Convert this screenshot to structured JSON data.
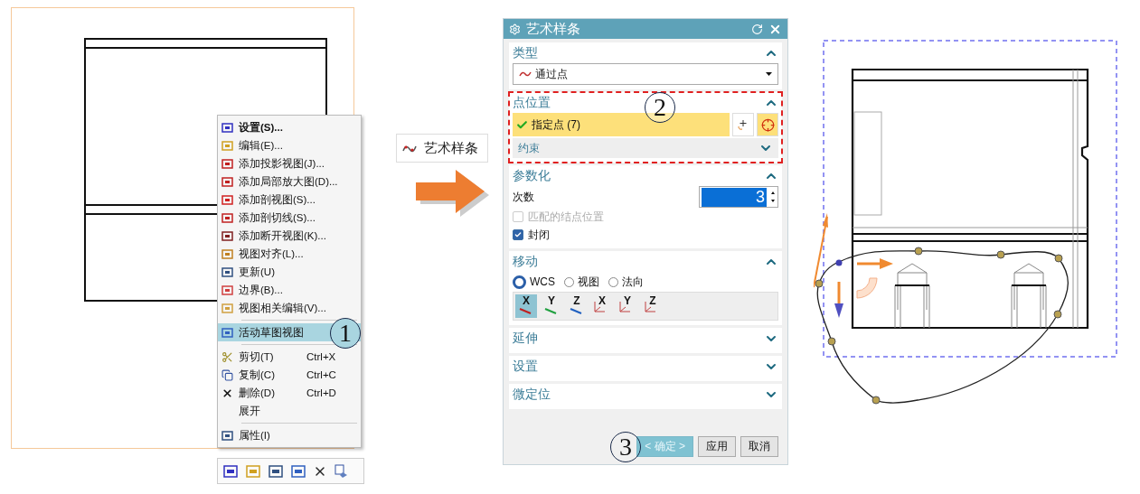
{
  "context_menu": {
    "callout": "1",
    "items": [
      {
        "kind": "item",
        "label": "设置(S)...",
        "bold": true,
        "selected": false
      },
      {
        "kind": "item",
        "label": "编辑(E)...",
        "bold": false,
        "selected": false
      },
      {
        "kind": "item",
        "label": "添加投影视图(J)...",
        "bold": false,
        "selected": false
      },
      {
        "kind": "item",
        "label": "添加局部放大图(D)...",
        "bold": false,
        "selected": false
      },
      {
        "kind": "item",
        "label": "添加剖视图(S)...",
        "bold": false,
        "selected": false
      },
      {
        "kind": "item",
        "label": "添加剖切线(S)...",
        "bold": false,
        "selected": false
      },
      {
        "kind": "item",
        "label": "添加断开视图(K)...",
        "bold": false,
        "selected": false
      },
      {
        "kind": "item",
        "label": "视图对齐(L)...",
        "bold": false,
        "selected": false
      },
      {
        "kind": "item",
        "label": "更新(U)",
        "bold": false,
        "selected": false
      },
      {
        "kind": "item",
        "label": "边界(B)...",
        "bold": false,
        "selected": false
      },
      {
        "kind": "item",
        "label": "视图相关编辑(V)...",
        "bold": false,
        "selected": false
      },
      {
        "kind": "separator"
      },
      {
        "kind": "item",
        "label": "活动草图视图",
        "bold": false,
        "selected": true
      },
      {
        "kind": "separator"
      },
      {
        "kind": "item",
        "label": "剪切(T)",
        "shortcut": "Ctrl+X",
        "bold": false,
        "selected": false
      },
      {
        "kind": "item",
        "label": "复制(C)",
        "shortcut": "Ctrl+C",
        "bold": false,
        "selected": false
      },
      {
        "kind": "item",
        "label": "删除(D)",
        "shortcut": "Ctrl+D",
        "bold": false,
        "selected": false
      },
      {
        "kind": "item",
        "label": "展开",
        "bold": false,
        "selected": false
      },
      {
        "kind": "separator"
      },
      {
        "kind": "item",
        "label": "属性(I)",
        "bold": false,
        "selected": false
      }
    ]
  },
  "command_button": {
    "label": "艺术样条"
  },
  "dialog": {
    "title": "艺术样条",
    "sections": [
      {
        "kind": "type",
        "title": "类型",
        "expanded": true,
        "value": "通过点"
      },
      {
        "kind": "points",
        "title": "点位置",
        "expanded": true,
        "highlighted": true,
        "callout": "2",
        "selector": {
          "label": "指定点 (7)",
          "done": true
        },
        "subsection": {
          "title": "约束",
          "expanded": false
        }
      },
      {
        "kind": "param",
        "title": "参数化",
        "expanded": true,
        "degree_label": "次数",
        "degree": "3",
        "options": [
          {
            "label": "匹配的结点位置",
            "checked": false,
            "disabled": true
          },
          {
            "label": "封闭",
            "checked": true,
            "disabled": false
          }
        ]
      },
      {
        "kind": "move",
        "title": "移动",
        "expanded": true,
        "radios": [
          {
            "label": "WCS",
            "selected": true
          },
          {
            "label": "视图",
            "selected": false
          },
          {
            "label": "法向",
            "selected": false
          }
        ],
        "axes": [
          {
            "kind": "axis",
            "label": "X",
            "selected": true
          },
          {
            "kind": "axis",
            "label": "Y",
            "selected": false
          },
          {
            "kind": "axis",
            "label": "Z",
            "selected": false
          },
          {
            "kind": "plane",
            "label": "X",
            "selected": false
          },
          {
            "kind": "plane",
            "label": "Y",
            "selected": false
          },
          {
            "kind": "plane",
            "label": "Z",
            "selected": false
          }
        ]
      },
      {
        "kind": "plain",
        "title": "延伸",
        "expanded": false
      },
      {
        "kind": "plain",
        "title": "设置",
        "expanded": false
      },
      {
        "kind": "plain",
        "title": "微定位",
        "expanded": false
      }
    ],
    "callout": "3",
    "buttons": [
      {
        "label": "< 确定 >",
        "default": true
      },
      {
        "label": "应用",
        "default": false
      },
      {
        "label": "取消",
        "default": false
      }
    ]
  }
}
